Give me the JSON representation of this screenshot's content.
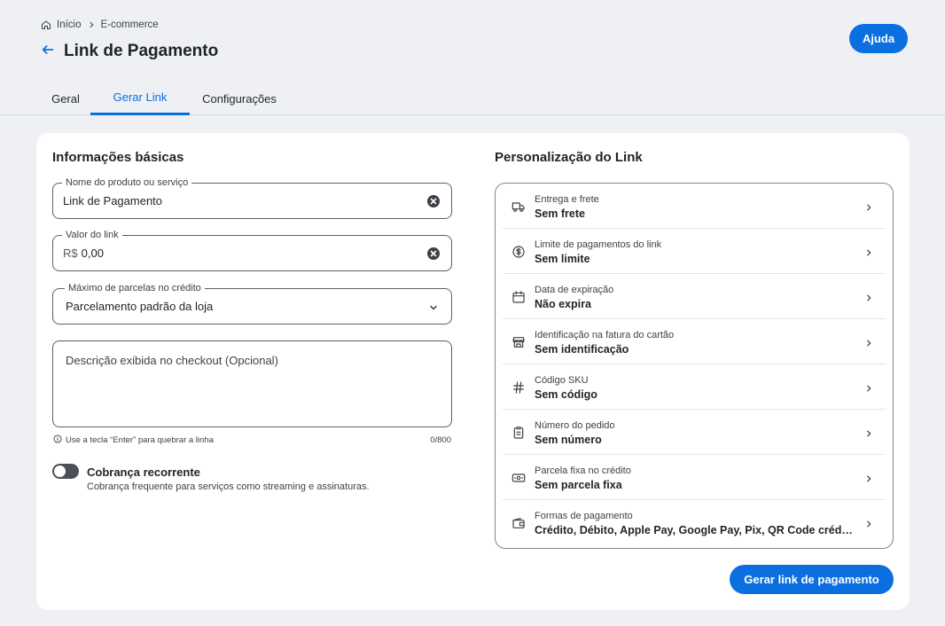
{
  "breadcrumb": {
    "home": "Início",
    "current": "E-commerce"
  },
  "header": {
    "title": "Link de Pagamento",
    "help_label": "Ajuda"
  },
  "tabs": [
    {
      "label": "Geral",
      "active": false
    },
    {
      "label": "Gerar Link",
      "active": true
    },
    {
      "label": "Configurações",
      "active": false
    }
  ],
  "basic": {
    "title": "Informações básicas",
    "product": {
      "label": "Nome do produto ou serviço",
      "value": "Link de Pagamento"
    },
    "amount": {
      "label": "Valor do link",
      "prefix": "R$",
      "value": "0,00"
    },
    "installments": {
      "label": "Máximo de parcelas no crédito",
      "value": "Parcelamento padrão da loja"
    },
    "description": {
      "placeholder": "Descrição exibida no checkout (Opcional)"
    },
    "hint": "Use a tecla “Enter” para quebrar a linha",
    "counter": "0/800",
    "recurring": {
      "title": "Cobrança recorrente",
      "description": "Cobrança frequente para serviços como streaming e assinaturas.",
      "enabled": false
    }
  },
  "custom": {
    "title": "Personalização do Link",
    "items": [
      {
        "icon": "truck-icon",
        "label": "Entrega e frete",
        "value": "Sem frete"
      },
      {
        "icon": "dollar-circle-icon",
        "label": "Limite de pagamentos do link",
        "value": "Sem limite"
      },
      {
        "icon": "calendar-icon",
        "label": "Data de expiração",
        "value": "Não expira"
      },
      {
        "icon": "store-icon",
        "label": "Identificação na fatura do cartão",
        "value": "Sem identificação"
      },
      {
        "icon": "hash-icon",
        "label": "Código SKU",
        "value": "Sem código"
      },
      {
        "icon": "clipboard-icon",
        "label": "Número do pedido",
        "value": "Sem número"
      },
      {
        "icon": "banknote-icon",
        "label": "Parcela fixa no crédito",
        "value": "Sem parcela fixa"
      },
      {
        "icon": "wallet-icon",
        "label": "Formas de pagamento",
        "value": "Crédito, Débito, Apple Pay, Google Pay, Pix, QR Code crédito"
      }
    ]
  },
  "actions": {
    "generate_label": "Gerar link de pagamento"
  },
  "colors": {
    "primary": "#0b6fe0",
    "background": "#eef0f3",
    "card": "#ffffff"
  }
}
